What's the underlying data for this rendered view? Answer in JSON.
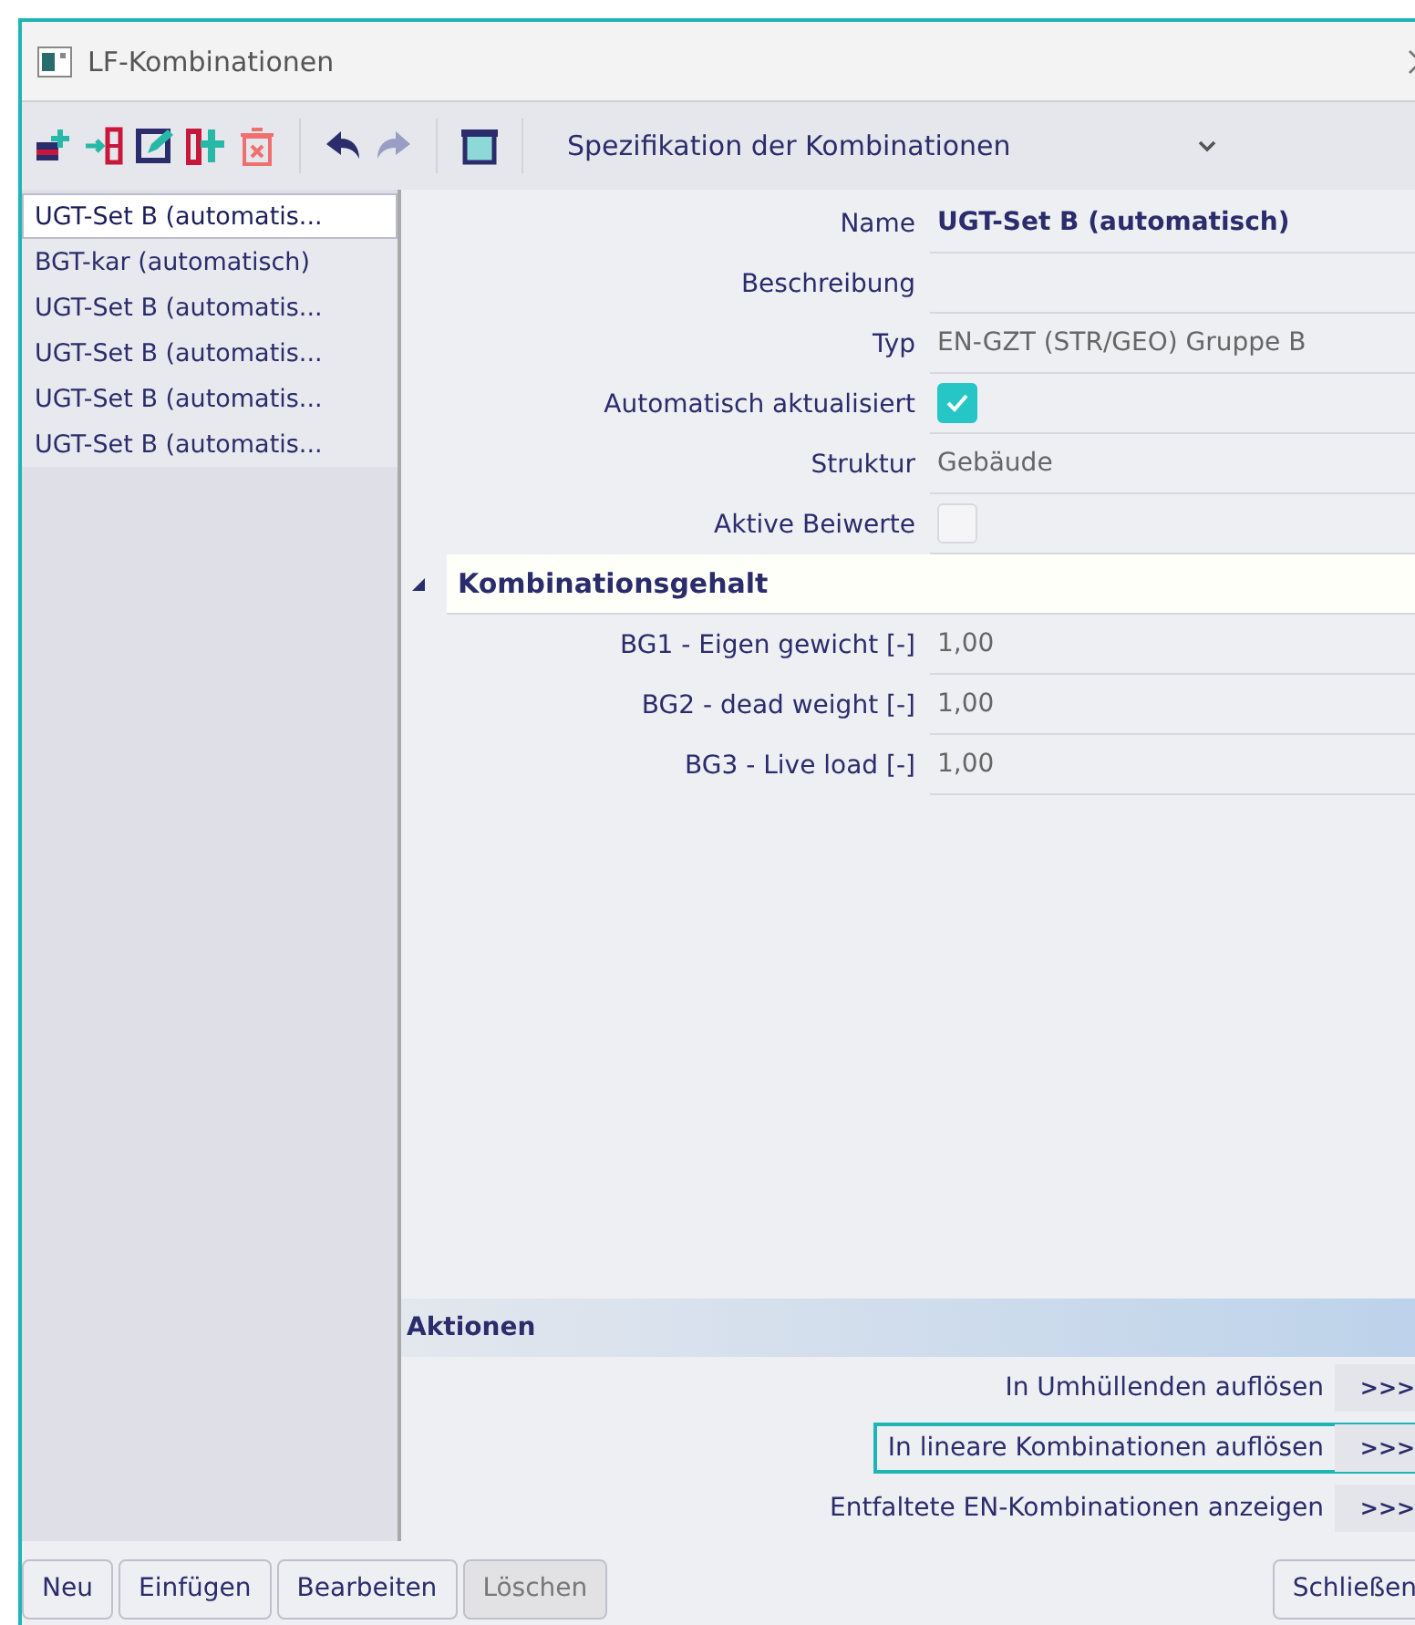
{
  "window": {
    "title": "LF-Kombinationen"
  },
  "toolbar": {
    "combo": "Spezifikation der Kombinationen"
  },
  "list": [
    {
      "label": "UGT-Set B (automatis...",
      "selected": true
    },
    {
      "label": "BGT-kar (automatisch)",
      "selected": false
    },
    {
      "label": "UGT-Set B (automatis...",
      "selected": false
    },
    {
      "label": "UGT-Set B (automatis...",
      "selected": false
    },
    {
      "label": "UGT-Set B (automatis...",
      "selected": false
    },
    {
      "label": "UGT-Set B (automatis...",
      "selected": false
    }
  ],
  "properties": [
    {
      "kind": "text",
      "label": "Name",
      "value": "UGT-Set B (automatisch)",
      "bold": true
    },
    {
      "kind": "text",
      "label": "Beschreibung"
    },
    {
      "kind": "text",
      "label": "Typ",
      "value": "EN-GZT (STR/GEO) Gruppe B",
      "bold": false
    },
    {
      "kind": "checkbox",
      "label": "Automatisch aktualisiert",
      "checked": true
    },
    {
      "kind": "text",
      "label": "Struktur",
      "value": "Gebäude",
      "bold": false
    },
    {
      "kind": "checkbox",
      "label": "Aktive Beiwerte",
      "checked": false
    }
  ],
  "group": {
    "title": "Kombinationsgehalt",
    "expanded": true,
    "rows": [
      {
        "label": "BG1 - Eigen gewicht [-]",
        "value": "1,00"
      },
      {
        "label": "BG2 - dead weight [-]",
        "value": "1,00"
      },
      {
        "label": "BG3 - Live load [-]",
        "value": "1,00"
      }
    ]
  },
  "actions": {
    "title": "Aktionen",
    "items": [
      {
        "label": "In Umhüllenden auflösen",
        "button": ">>>",
        "focused": false
      },
      {
        "label": "In lineare Kombinationen auflösen",
        "button": ">>>",
        "focused": true
      },
      {
        "label": "Entfaltete EN-Kombinationen anzeigen",
        "button": ">>>",
        "focused": false
      }
    ]
  },
  "buttons": [
    {
      "label": "Neu",
      "disabled": false
    },
    {
      "label": "Einfügen",
      "disabled": false
    },
    {
      "label": "Bearbeiten",
      "disabled": false
    },
    {
      "label": "Löschen",
      "disabled": true
    }
  ],
  "close_button": "Schließen"
}
